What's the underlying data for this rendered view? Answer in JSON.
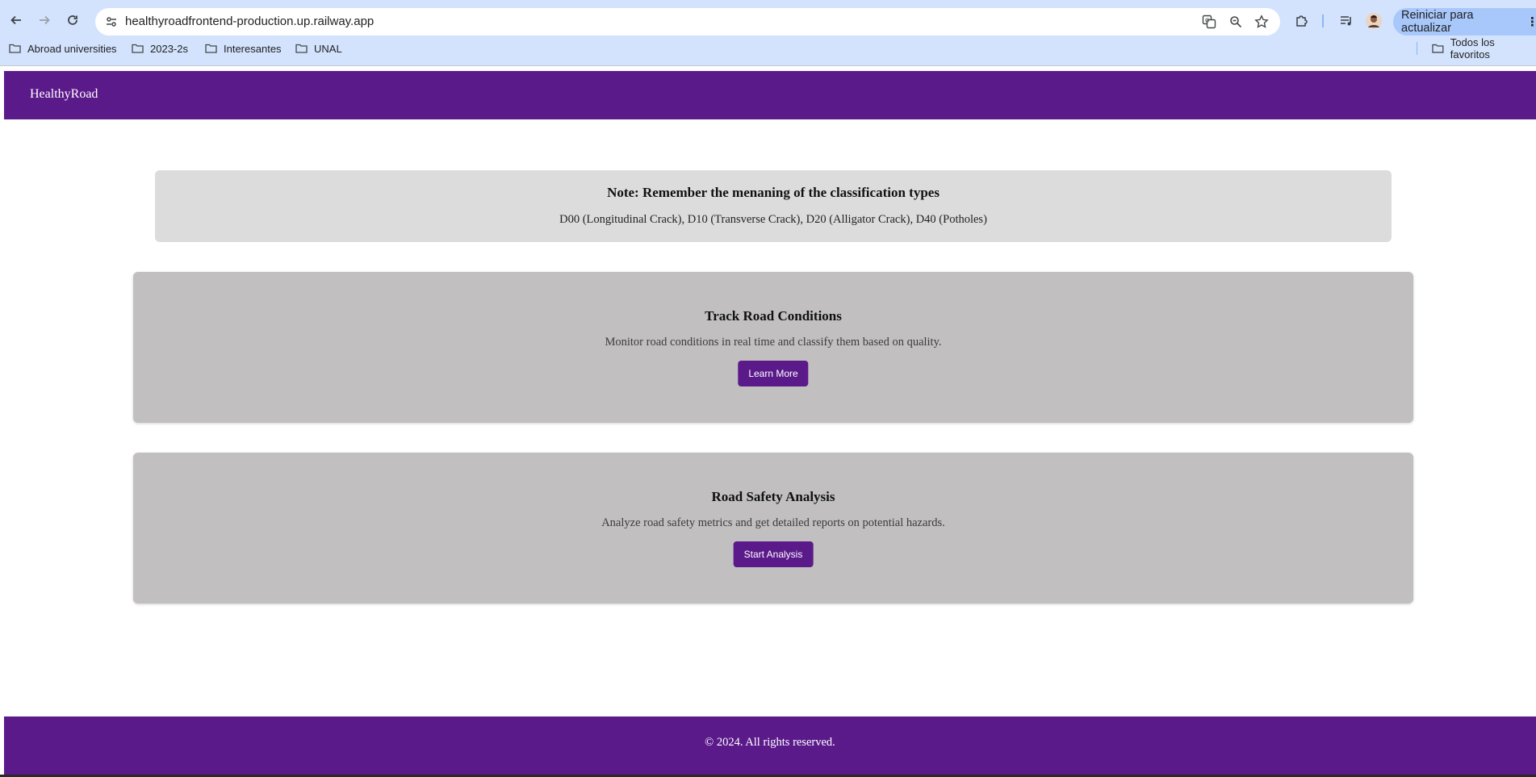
{
  "browser": {
    "url": "healthyroadfrontend-production.up.railway.app",
    "restart_label": "Reiniciar para actualizar",
    "bookmarks": [
      "Abroad universities",
      "2023-2s",
      "Interesantes",
      "UNAL"
    ],
    "all_bookmarks_label": "Todos los favoritos"
  },
  "header": {
    "brand": "HealthyRoad"
  },
  "note": {
    "title": "Note: Remember the menaning of the classification types",
    "text": "D00 (Longitudinal Crack), D10 (Transverse Crack), D20 (Alligator Crack), D40 (Potholes)"
  },
  "cards": [
    {
      "title": "Track Road Conditions",
      "description": "Monitor road conditions in real time and classify them based on quality.",
      "button": "Learn More"
    },
    {
      "title": "Road Safety Analysis",
      "description": "Analyze road safety metrics and get detailed reports on potential hazards.",
      "button": "Start Analysis"
    }
  ],
  "footer": {
    "text": "© 2024. All rights reserved."
  },
  "colors": {
    "brand": "#5b1a8a",
    "card_bg": "#c1bfc0",
    "note_bg": "#dcdcdc"
  },
  "icons": [
    "back-icon",
    "forward-icon",
    "reload-icon",
    "site-info-icon",
    "translate-icon",
    "zoom-icon",
    "star-icon",
    "extensions-icon",
    "media-icon",
    "profile-avatar",
    "menu-icon",
    "folder-icon"
  ]
}
